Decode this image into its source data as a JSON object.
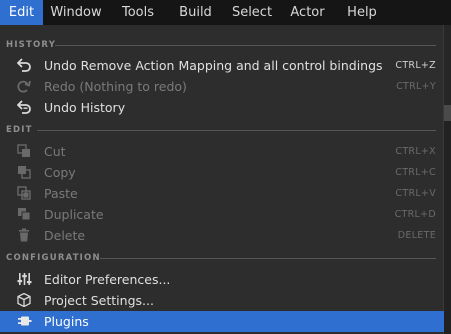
{
  "menubar": {
    "items": [
      {
        "label": "Edit"
      },
      {
        "label": "Window"
      },
      {
        "label": "Tools"
      },
      {
        "label": "Build"
      },
      {
        "label": "Select"
      },
      {
        "label": "Actor"
      },
      {
        "label": "Help"
      }
    ],
    "active": "Edit"
  },
  "dropdown": {
    "sections": [
      {
        "header": "HISTORY",
        "items": [
          {
            "label": "Undo Remove Action Mapping and all control bindings",
            "shortcut": "CTRL+Z",
            "icon": "undo-icon",
            "enabled": true
          },
          {
            "label": "Redo (Nothing to redo)",
            "shortcut": "CTRL+Y",
            "icon": "redo-icon",
            "enabled": false
          },
          {
            "label": "Undo History",
            "shortcut": "",
            "icon": "undo-history-icon",
            "enabled": true
          }
        ]
      },
      {
        "header": "EDIT",
        "items": [
          {
            "label": "Cut",
            "shortcut": "CTRL+X",
            "icon": "cut-icon",
            "enabled": false
          },
          {
            "label": "Copy",
            "shortcut": "CTRL+C",
            "icon": "copy-icon",
            "enabled": false
          },
          {
            "label": "Paste",
            "shortcut": "CTRL+V",
            "icon": "paste-icon",
            "enabled": false
          },
          {
            "label": "Duplicate",
            "shortcut": "CTRL+D",
            "icon": "duplicate-icon",
            "enabled": false
          },
          {
            "label": "Delete",
            "shortcut": "DELETE",
            "icon": "trash-icon",
            "enabled": false
          }
        ]
      },
      {
        "header": "CONFIGURATION",
        "items": [
          {
            "label": "Editor Preferences...",
            "shortcut": "",
            "icon": "sliders-icon",
            "enabled": true
          },
          {
            "label": "Project Settings...",
            "shortcut": "",
            "icon": "project-settings-icon",
            "enabled": true
          },
          {
            "label": "Plugins",
            "shortcut": "",
            "icon": "plugin-icon",
            "enabled": true,
            "highlighted": true
          }
        ]
      }
    ]
  },
  "colors": {
    "accent": "#2f6fd0",
    "menu_bg": "#2d2d2d",
    "menubar_bg": "#151515",
    "text": "#e0e0e0",
    "disabled_text": "#7a7a7a"
  }
}
